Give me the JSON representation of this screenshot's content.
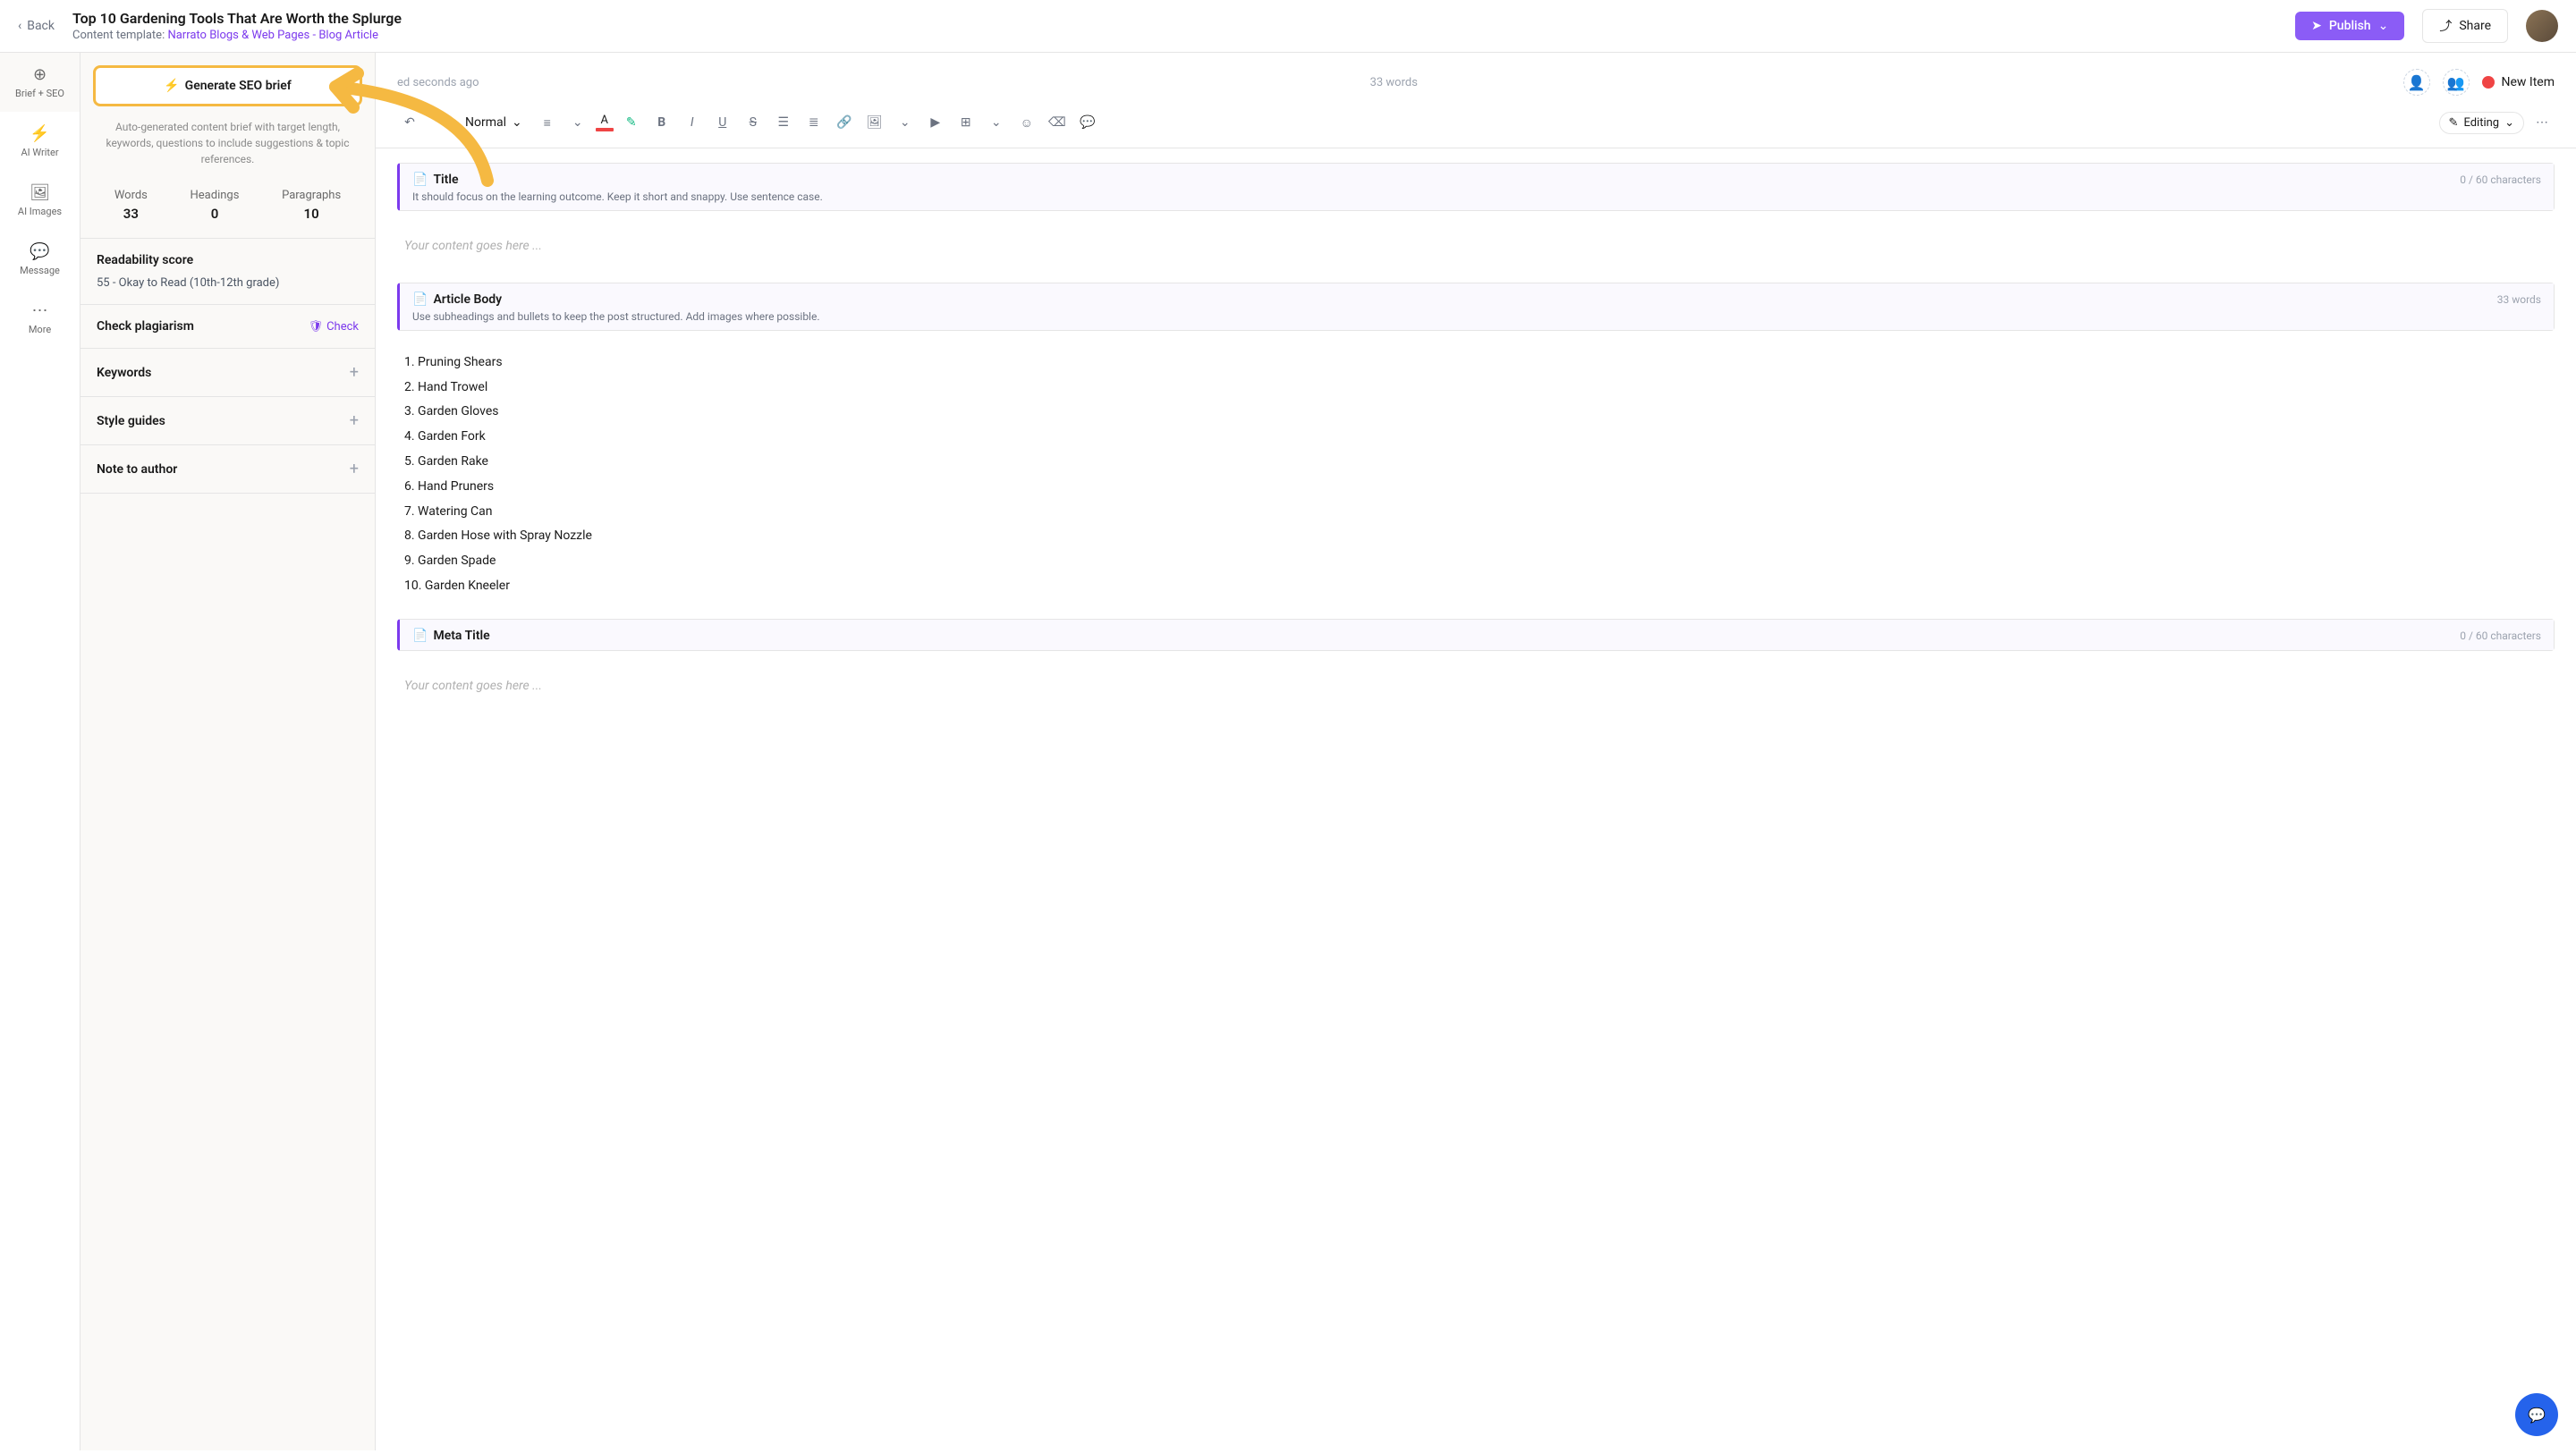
{
  "header": {
    "back": "Back",
    "title": "Top 10 Gardening Tools That Are Worth the Splurge",
    "template_label": "Content template:",
    "template_name": "Narrato Blogs & Web Pages - Blog Article",
    "publish": "Publish",
    "share": "Share"
  },
  "rail": {
    "brief": "Brief + SEO",
    "writer": "AI Writer",
    "images": "AI Images",
    "message": "Message",
    "more": "More"
  },
  "side": {
    "seo_brief_btn": "Generate SEO brief",
    "seo_brief_desc": "Auto-generated content brief with target length, keywords, questions to include suggestions & topic references.",
    "stats": {
      "words_label": "Words",
      "words_value": "33",
      "headings_label": "Headings",
      "headings_value": "0",
      "paragraphs_label": "Paragraphs",
      "paragraphs_value": "10"
    },
    "readability_title": "Readability score",
    "readability_text": "55 - Okay to Read (10th-12th grade)",
    "plagiarism_title": "Check plagiarism",
    "check_label": "Check",
    "keywords_title": "Keywords",
    "style_title": "Style guides",
    "note_title": "Note to author"
  },
  "editor": {
    "saved": "ed seconds ago",
    "word_count": "33 words",
    "status": "New Item",
    "format": "Normal",
    "mode": "Editing",
    "title_block": {
      "name": "Title",
      "meta": "0 / 60 characters",
      "hint": "It should focus on the learning outcome. Keep it short and snappy. Use sentence case.",
      "placeholder": "Your content goes here ..."
    },
    "body_block": {
      "name": "Article Body",
      "meta": "33 words",
      "hint": "Use subheadings and bullets to keep the post structured. Add images where possible.",
      "items": [
        "1. Pruning Shears",
        "2. Hand Trowel",
        "3. Garden Gloves",
        "4. Garden Fork",
        "5. Garden Rake",
        "6. Hand Pruners",
        "7. Watering Can",
        "8. Garden Hose with Spray Nozzle",
        "9. Garden Spade",
        "10. Garden Kneeler"
      ]
    },
    "meta_block": {
      "name": "Meta Title",
      "meta": "0 / 60 characters",
      "placeholder": "Your content goes here ..."
    }
  }
}
